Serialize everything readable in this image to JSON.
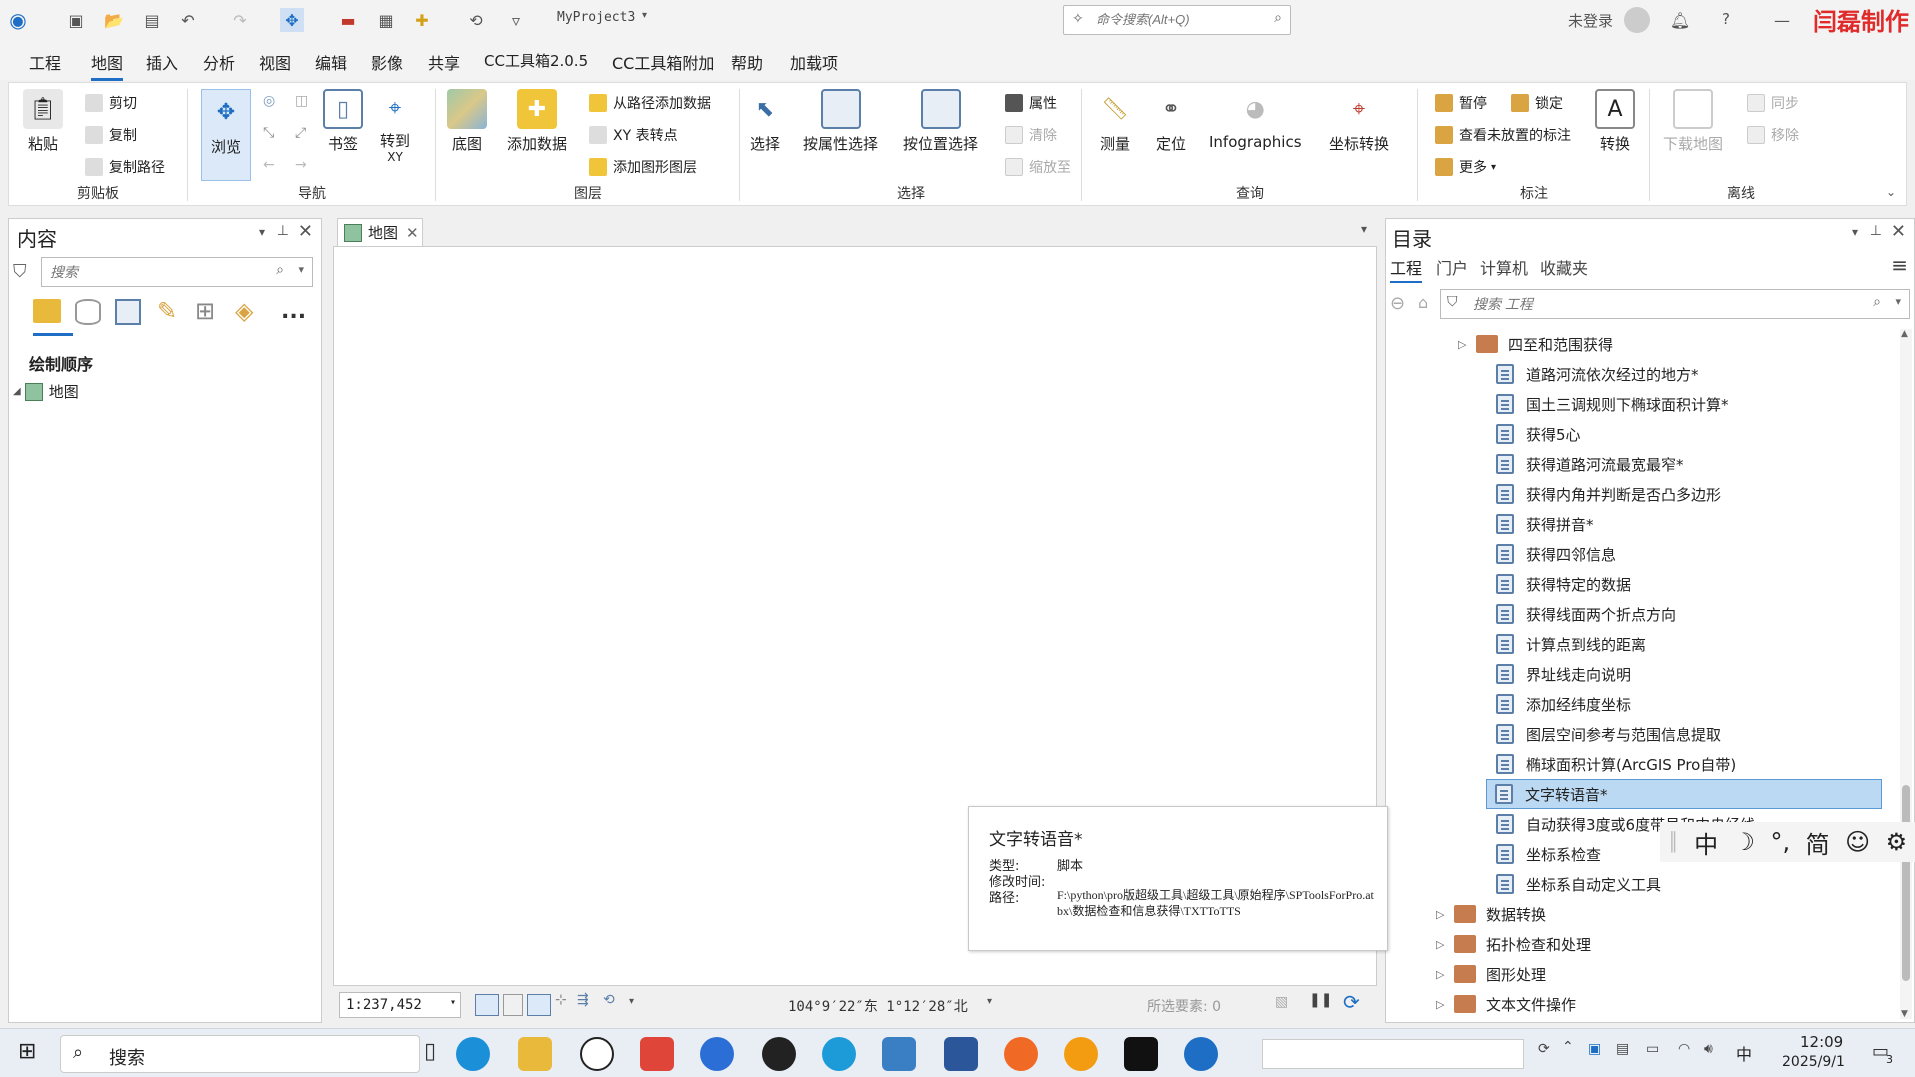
{
  "titlebar": {
    "project": "MyProject3",
    "search_placeholder": "命令搜索(Alt+Q)",
    "login": "未登录",
    "help": "?",
    "watermark": "闫磊制作"
  },
  "menu": [
    "工程",
    "地图",
    "插入",
    "分析",
    "视图",
    "编辑",
    "影像",
    "共享",
    "CC工具箱2.0.5",
    "CC工具箱附加",
    "帮助",
    "加载项"
  ],
  "ribbon": {
    "clipboard": {
      "title": "剪贴板",
      "paste": "粘贴",
      "cut": "剪切",
      "copy": "复制",
      "copy_path": "复制路径"
    },
    "navigate": {
      "title": "导航",
      "explore": "浏览",
      "bookmarks": "书签",
      "goto1": "转到",
      "goto2": "XY"
    },
    "layer": {
      "title": "图层",
      "basemap": "底图",
      "add_data": "添加数据",
      "add_from_path": "从路径添加数据",
      "xy_to_point": "XY 表转点",
      "add_graphics": "添加图形图层"
    },
    "selection": {
      "title": "选择",
      "select": "选择",
      "by_attr": "按属性选择",
      "by_loc": "按位置选择",
      "attributes": "属性",
      "clear": "清除",
      "zoom_to": "缩放至"
    },
    "inquiry": {
      "title": "查询",
      "measure": "测量",
      "locate": "定位",
      "infographics": "Infographics",
      "coord_conv": "坐标转换"
    },
    "labeling": {
      "title": "标注",
      "pause": "暂停",
      "lock": "锁定",
      "unplaced": "查看未放置的标注",
      "more": "更多",
      "convert": "转换"
    },
    "offline": {
      "title": "离线",
      "download": "下载地图",
      "sync": "同步",
      "remove": "移除"
    }
  },
  "contents": {
    "title": "内容",
    "search_placeholder": "搜索",
    "drawing_order": "绘制顺序",
    "map_item": "地图",
    "more": "..."
  },
  "map": {
    "tab": "地图",
    "scale": "1:237,452",
    "coords": "104°9′22″东 1°12′28″北",
    "selected": "所选要素: 0"
  },
  "catalog": {
    "title": "目录",
    "tabs": [
      "工程",
      "门户",
      "计算机",
      "收藏夹"
    ],
    "search_placeholder": "搜索 工程",
    "toolbox_top": "四至和范围获得",
    "scripts": [
      "道路河流依次经过的地方*",
      "国土三调规则下椭球面积计算*",
      "获得5心",
      "获得道路河流最宽最窄*",
      "获得内角并判断是否凸多边形",
      "获得拼音*",
      "获得四邻信息",
      "获得特定的数据",
      "获得线面两个折点方向",
      "计算点到线的距离",
      "界址线走向说明",
      "添加经纬度坐标",
      "图层空间参考与范围信息提取",
      "椭球面积计算(ArcGIS Pro自带)",
      "文字转语音*",
      "自动获得3度或6度带号和中央经线",
      "坐标系检查",
      "坐标系自动定义工具"
    ],
    "selected_index": 14,
    "toolboxes": [
      "数据转换",
      "拓扑检查和处理",
      "图形处理",
      "文本文件操作"
    ]
  },
  "tooltip": {
    "title": "文字转语音*",
    "type_label": "类型:",
    "type_value": "脚本",
    "modified_label": "修改时间:",
    "path_label": "路径:",
    "path_value": "F:\\python\\pro版超级工具\\超级工具\\原始程序\\SPToolsForPro.atbx\\数据检查和信息获得\\TXTToTTS"
  },
  "ime": [
    "中",
    "☽",
    "°,",
    "简",
    "☺",
    "⚙"
  ],
  "taskbar": {
    "search": "搜索",
    "time": "12:09",
    "date": "2025/9/1",
    "ime": "中",
    "notif": "3"
  }
}
